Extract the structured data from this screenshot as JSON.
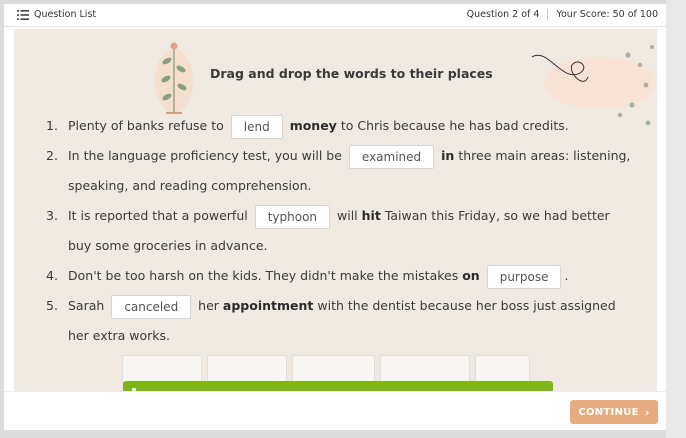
{
  "topbar": {
    "question_list_label": "Question List",
    "question_progress": "Question 2 of 4",
    "score": "Your Score: 50 of 100"
  },
  "heading": "Drag and drop the words to their places",
  "questions": [
    {
      "num": "1.",
      "p1": "Plenty of banks refuse to",
      "answer": "lend",
      "bold": "money",
      "p2": "to Chris because he has bad credits."
    },
    {
      "num": "2.",
      "p1": "In the language proficiency test, you will be",
      "answer": "examined",
      "bold": "in",
      "p2": "three main areas: listening, speaking, and reading comprehension."
    },
    {
      "num": "3.",
      "p1": "It is reported that a powerful",
      "answer": "typhoon",
      "bold1": "will",
      "bold2": "hit",
      "p2": "Taiwan this Friday, so we had better buy some groceries in advance."
    },
    {
      "num": "4.",
      "p1": "Don't be too harsh on the kids. They didn't make the mistakes",
      "bold": "on",
      "answer": "purpose",
      "p2": "."
    },
    {
      "num": "5.",
      "p1": "Sarah",
      "answer": "canceled",
      "p2": "her",
      "bold": "appointment",
      "p3": "with the dentist because her boss just assigned her extra works."
    }
  ],
  "footer": {
    "continue_label": "CONTINUE",
    "continue_icon": "chevron-right-icon"
  },
  "colors": {
    "content_bg": "#efe9e2",
    "continue_bg": "#e8ab7f",
    "feedback_green": "#7db51b"
  }
}
